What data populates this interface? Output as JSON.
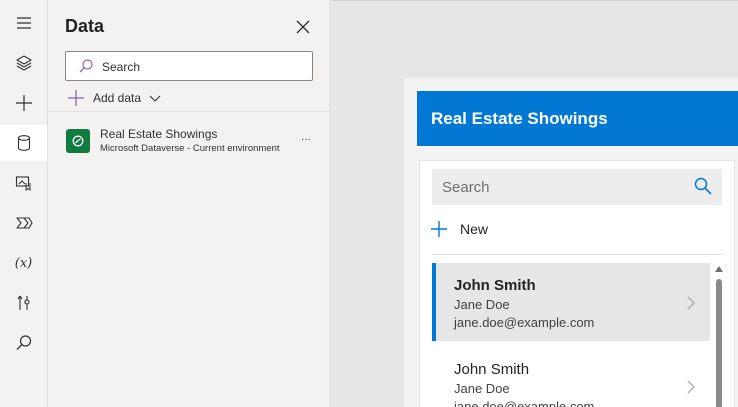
{
  "rail": {
    "items": [
      {
        "icon": "layers-icon",
        "active": false
      },
      {
        "icon": "plus-icon",
        "active": false
      },
      {
        "icon": "database-icon",
        "active": true
      },
      {
        "icon": "media-icon",
        "active": false
      },
      {
        "icon": "power-automate-icon",
        "active": false
      },
      {
        "icon": "variables-icon",
        "active": false
      },
      {
        "icon": "tools-icon",
        "active": false
      },
      {
        "icon": "search-icon",
        "active": false
      }
    ],
    "variables_label": "(x)"
  },
  "data_pane": {
    "title": "Data",
    "search_placeholder": "Search",
    "add_data_label": "Add data",
    "sources": [
      {
        "name": "Real Estate Showings",
        "subtitle": "Microsoft Dataverse - Current environment",
        "more": "..."
      }
    ]
  },
  "app": {
    "header_title": "Real Estate Showings",
    "search_placeholder": "Search",
    "new_label": "New",
    "accent_color": "#0078d4",
    "items": [
      {
        "title": "John Smith",
        "name": "Jane Doe",
        "email": "jane.doe@example.com",
        "selected": true
      },
      {
        "title": "John Smith",
        "name": "Jane Doe",
        "email": "jane.doe@example.com",
        "selected": false
      }
    ]
  }
}
